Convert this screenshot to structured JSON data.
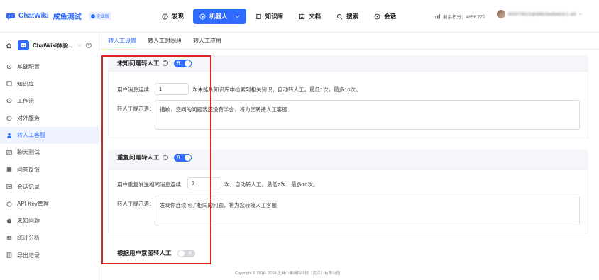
{
  "header": {
    "logo_text": "ChatWiki",
    "logo_sub": "咸鱼测试",
    "badge": "企业版",
    "nav": [
      {
        "label": "发现",
        "icon": "compass-icon",
        "active": false
      },
      {
        "label": "机器人",
        "icon": "robot-icon",
        "active": true
      },
      {
        "label": "知识库",
        "icon": "book-icon",
        "active": false
      },
      {
        "label": "文档",
        "icon": "document-icon",
        "active": false
      },
      {
        "label": "搜索",
        "icon": "search-icon",
        "active": false
      },
      {
        "label": "会话",
        "icon": "chat-icon",
        "active": false
      }
    ],
    "points_label": "剩余积分：4856,770",
    "user_name": "800079815@886c9e8beb3c1.skf"
  },
  "sidebar": {
    "robot_name": "ChatWiki体验...",
    "items": [
      {
        "label": "基础配置",
        "icon": "gear-icon"
      },
      {
        "label": "知识库",
        "icon": "book-icon"
      },
      {
        "label": "工作流",
        "icon": "workflow-icon"
      },
      {
        "label": "对外服务",
        "icon": "chat-bubble-icon"
      },
      {
        "label": "转人工客服",
        "icon": "headset-icon",
        "active": true
      },
      {
        "label": "聊天测试",
        "icon": "test-icon"
      },
      {
        "label": "问答反馈",
        "icon": "feedback-icon"
      },
      {
        "label": "会话记录",
        "icon": "record-icon"
      },
      {
        "label": "API Key管理",
        "icon": "key-icon"
      },
      {
        "label": "未知问题",
        "icon": "question-icon"
      },
      {
        "label": "统计分析",
        "icon": "chart-icon"
      },
      {
        "label": "导出记录",
        "icon": "export-icon"
      }
    ]
  },
  "tabs": [
    "转人工设置",
    "转人工时间段",
    "转人工应用"
  ],
  "unknown_section": {
    "title": "未知问题转人工",
    "toggle_label": "开",
    "count_label": "用户消息连续",
    "count_value": "1",
    "count_suffix": "次未能从知识库中检索到相关知识，自动转人工。最低1次，最多10次。",
    "prompt_label": "转人工提示语：",
    "prompt_value": "抱歉，您问的问题我还没有学会，将为您转接人工客服"
  },
  "repeat_section": {
    "title": "重复问题转人工",
    "toggle_label": "开",
    "count_label": "用户重复发送相同消息连续",
    "count_value": "3",
    "count_suffix": "次，自动转人工。最低2次，最多10次。",
    "prompt_label": "转人工提示语：",
    "prompt_value": "发现你连续问了相同的问题，将为您转接人工客服"
  },
  "intent_section": {
    "title": "根据用户意图转人工",
    "toggle_label": "关"
  },
  "footer": "Copyright © 2016- 2024 芝麻小事网络科技（武汉）有限公司"
}
